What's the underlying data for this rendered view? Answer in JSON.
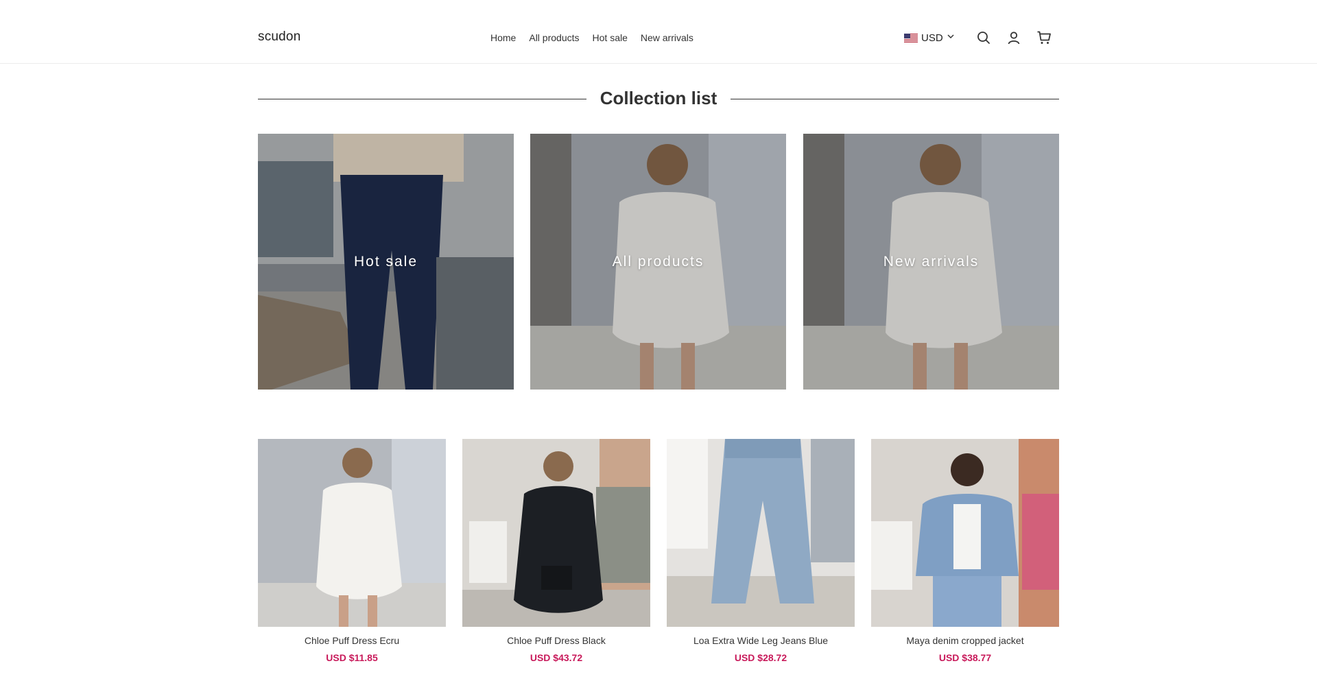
{
  "header": {
    "logo": "scudon",
    "nav": [
      "Home",
      "All products",
      "Hot sale",
      "New arrivals"
    ],
    "currency": {
      "code": "USD",
      "flag_icon": "us-flag-icon",
      "dropdown_icon": "chevron-down-icon"
    },
    "icons": [
      "search-icon",
      "account-icon",
      "cart-icon"
    ]
  },
  "section": {
    "title": "Collection list"
  },
  "collections": [
    {
      "label": "Hot sale",
      "image": "woman-in-dark-flare-jeans-photo"
    },
    {
      "label": "All products",
      "image": "woman-in-white-puff-dress-photo"
    },
    {
      "label": "New arrivals",
      "image": "woman-in-white-puff-dress-photo"
    }
  ],
  "products": [
    {
      "name": "Chloe Puff Dress Ecru",
      "price": "USD $11.85",
      "image": "white-puff-dress-photo"
    },
    {
      "name": "Chloe Puff Dress Black",
      "price": "USD $43.72",
      "image": "black-puff-dress-photo"
    },
    {
      "name": "Loa Extra Wide Leg Jeans Blue",
      "price": "USD $28.72",
      "image": "wide-leg-jeans-photo"
    },
    {
      "name": "Maya denim cropped jacket",
      "price": "USD $38.77",
      "image": "denim-jacket-photo"
    }
  ],
  "colors": {
    "price": "#c8195a",
    "divider": "#333333",
    "text": "#333333"
  }
}
